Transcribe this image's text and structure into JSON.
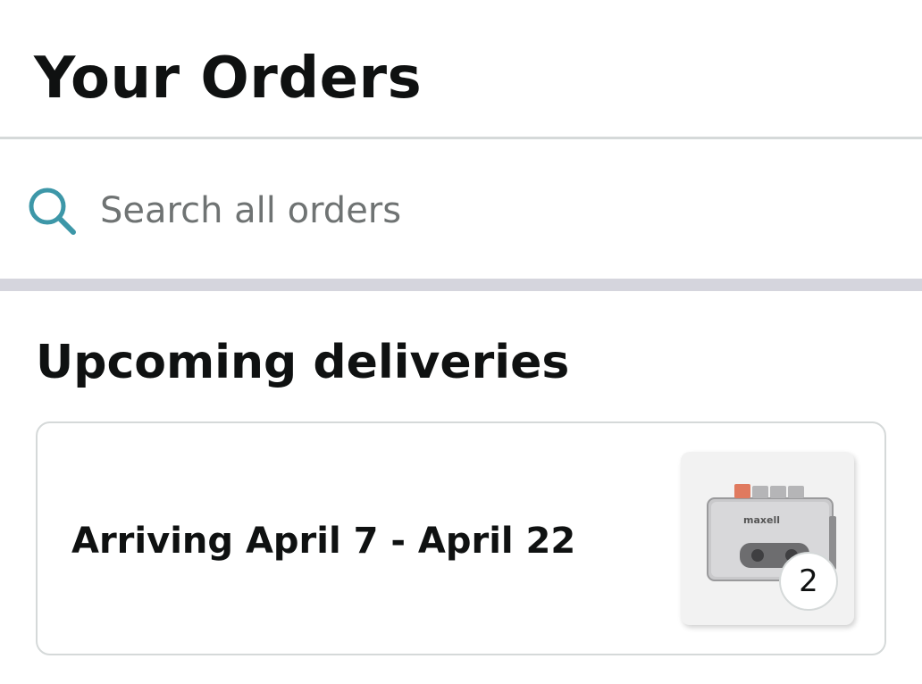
{
  "header": {
    "title": "Your Orders"
  },
  "search": {
    "placeholder": "Search all orders",
    "icon": "search-icon",
    "icon_color": "#3d97a8"
  },
  "upcoming": {
    "section_title": "Upcoming deliveries",
    "cards": [
      {
        "arrival_text": "Arriving April 7 - April 22",
        "product_image": "cassette-player-image",
        "product_brand_mark": "maxell",
        "quantity": "2"
      }
    ]
  },
  "colors": {
    "text_primary": "#0f1111",
    "text_muted": "#6f7373",
    "divider": "#d5d5dd",
    "card_border": "#d5d9d9"
  }
}
